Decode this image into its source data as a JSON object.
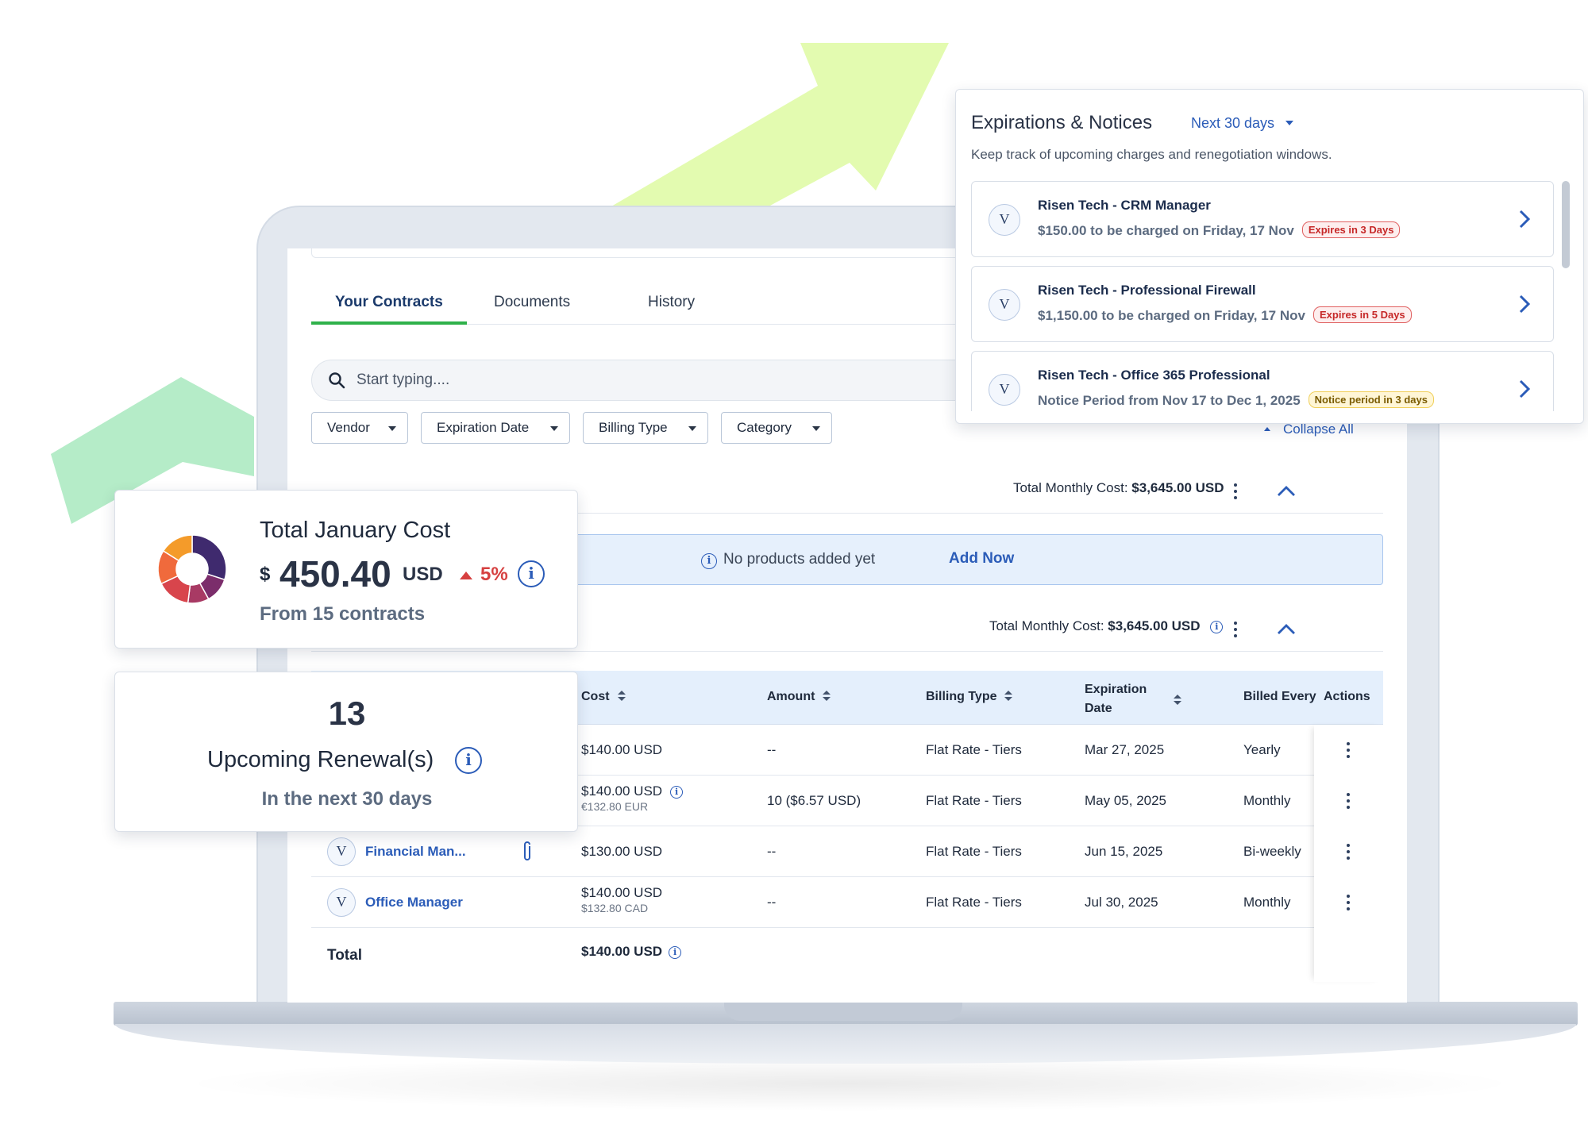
{
  "tabs": [
    {
      "label": "Your Contracts",
      "active": true
    },
    {
      "label": "Documents",
      "active": false
    },
    {
      "label": "History",
      "active": false
    }
  ],
  "search": {
    "placeholder": "Start typing...."
  },
  "filters": [
    "Vendor",
    "Expiration Date",
    "Billing Type",
    "Category"
  ],
  "collapse_all_label": "Collapse All",
  "groups": [
    {
      "total_label": "Total Monthly Cost:",
      "total_value": "$3,645.00 USD"
    },
    {
      "total_label": "Total Monthly Cost:",
      "total_value": "$3,645.00 USD"
    }
  ],
  "empty_banner": {
    "message": "No products added yet",
    "action": "Add Now"
  },
  "table": {
    "headers": {
      "cost": "Cost",
      "amount": "Amount",
      "billing_type": "Billing Type",
      "expiration_line1": "Expiration",
      "expiration_line2": "Date",
      "billed_every": "Billed Every",
      "actions": "Actions"
    },
    "rows": [
      {
        "product": "",
        "cost": "$140.00 USD",
        "cost_sub": "",
        "amount": "--",
        "billing_type": "Flat Rate - Tiers",
        "expiration": "Mar 27, 2025",
        "billed_every": "Yearly"
      },
      {
        "product": "",
        "cost": "$140.00 USD",
        "cost_sub": "€132.80 EUR",
        "amount": "10 ($6.57 USD)",
        "billing_type": "Flat Rate - Tiers",
        "expiration": "May 05, 2025",
        "billed_every": "Monthly"
      },
      {
        "product": "Financial Man...",
        "vendor_initial": "V",
        "cost": "$130.00 USD",
        "cost_sub": "",
        "amount": "--",
        "billing_type": "Flat Rate - Tiers",
        "expiration": "Jun 15, 2025",
        "billed_every": "Bi-weekly"
      },
      {
        "product": "Office Manager",
        "vendor_initial": "V",
        "cost": "$140.00 USD",
        "cost_sub": "$132.80 CAD",
        "amount": "--",
        "billing_type": "Flat Rate - Tiers",
        "expiration": "Jul 30, 2025",
        "billed_every": "Monthly"
      }
    ],
    "total_label": "Total",
    "total_value": "$140.00 USD"
  },
  "cost_card": {
    "title": "Total January Cost",
    "currency_symbol": "$",
    "value": "450.40",
    "unit": "USD",
    "change": "5%",
    "subtitle": "From 15 contracts",
    "donut_colors": [
      "#3f2a6e",
      "#7b2d6b",
      "#a83a64",
      "#d8454c",
      "#f06a3c",
      "#f49b2a"
    ]
  },
  "renewal_card": {
    "count": "13",
    "title": "Upcoming Renewal(s)",
    "subtitle": "In the next 30 days"
  },
  "expirations": {
    "title": "Expirations & Notices",
    "range": "Next 30 days",
    "description": "Keep track of upcoming charges and renegotiation windows.",
    "items": [
      {
        "initial": "V",
        "name": "Risen Tech - CRM Manager",
        "detail": "$150.00 to be charged on Friday, 17 Nov",
        "badge": "Expires in 3 Days",
        "badge_type": "red"
      },
      {
        "initial": "V",
        "name": "Risen Tech - Professional Firewall",
        "detail": "$1,150.00 to be charged on  Friday, 17 Nov",
        "badge": "Expires in 5 Days",
        "badge_type": "red"
      },
      {
        "initial": "V",
        "name": "Risen Tech - Office 365 Professional",
        "detail": "Notice Period from Nov 17 to Dec 1, 2025",
        "badge": "Notice period in 3 days",
        "badge_type": "yellow"
      }
    ]
  },
  "colors": {
    "accent": "#2b5cb8",
    "tab_active": "#2fb14a",
    "alert": "#d64040",
    "arrow_light": "#e3fbb0",
    "arrow_green": "#b5ecc8"
  }
}
